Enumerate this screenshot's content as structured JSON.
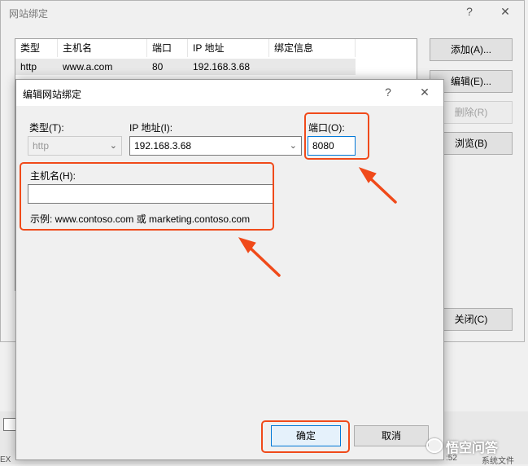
{
  "background_window": {
    "title": "网站绑定",
    "help": "?",
    "close": "✕",
    "columns": [
      "类型",
      "主机名",
      "端口",
      "IP 地址",
      "绑定信息"
    ],
    "rows": [
      {
        "type": "http",
        "host": "www.a.com",
        "port": "80",
        "ip": "192.168.3.68",
        "info": ""
      }
    ],
    "buttons": {
      "add": "添加(A)...",
      "edit": "编辑(E)...",
      "remove": "删除(R)",
      "browse": "浏览(B)",
      "close": "关闭(C)"
    }
  },
  "dialog": {
    "title": "编辑网站绑定",
    "help": "?",
    "close": "✕",
    "type_label": "类型(T):",
    "type_value": "http",
    "ip_label": "IP 地址(I):",
    "ip_value": "192.168.3.68",
    "port_label": "端口(O):",
    "port_value": "8080",
    "hostname_label": "主机名(H):",
    "hostname_value": "",
    "example": "示例: www.contoso.com 或 marketing.contoso.com",
    "ok": "确定",
    "cancel": "取消"
  },
  "statusbar": {
    "left_text": "EX",
    "right_text1": ":52",
    "right_text2": "系统文件"
  },
  "watermark": "悟空问答",
  "colors": {
    "highlight_red": "#f04a1a",
    "focus_blue": "#0078d7"
  }
}
